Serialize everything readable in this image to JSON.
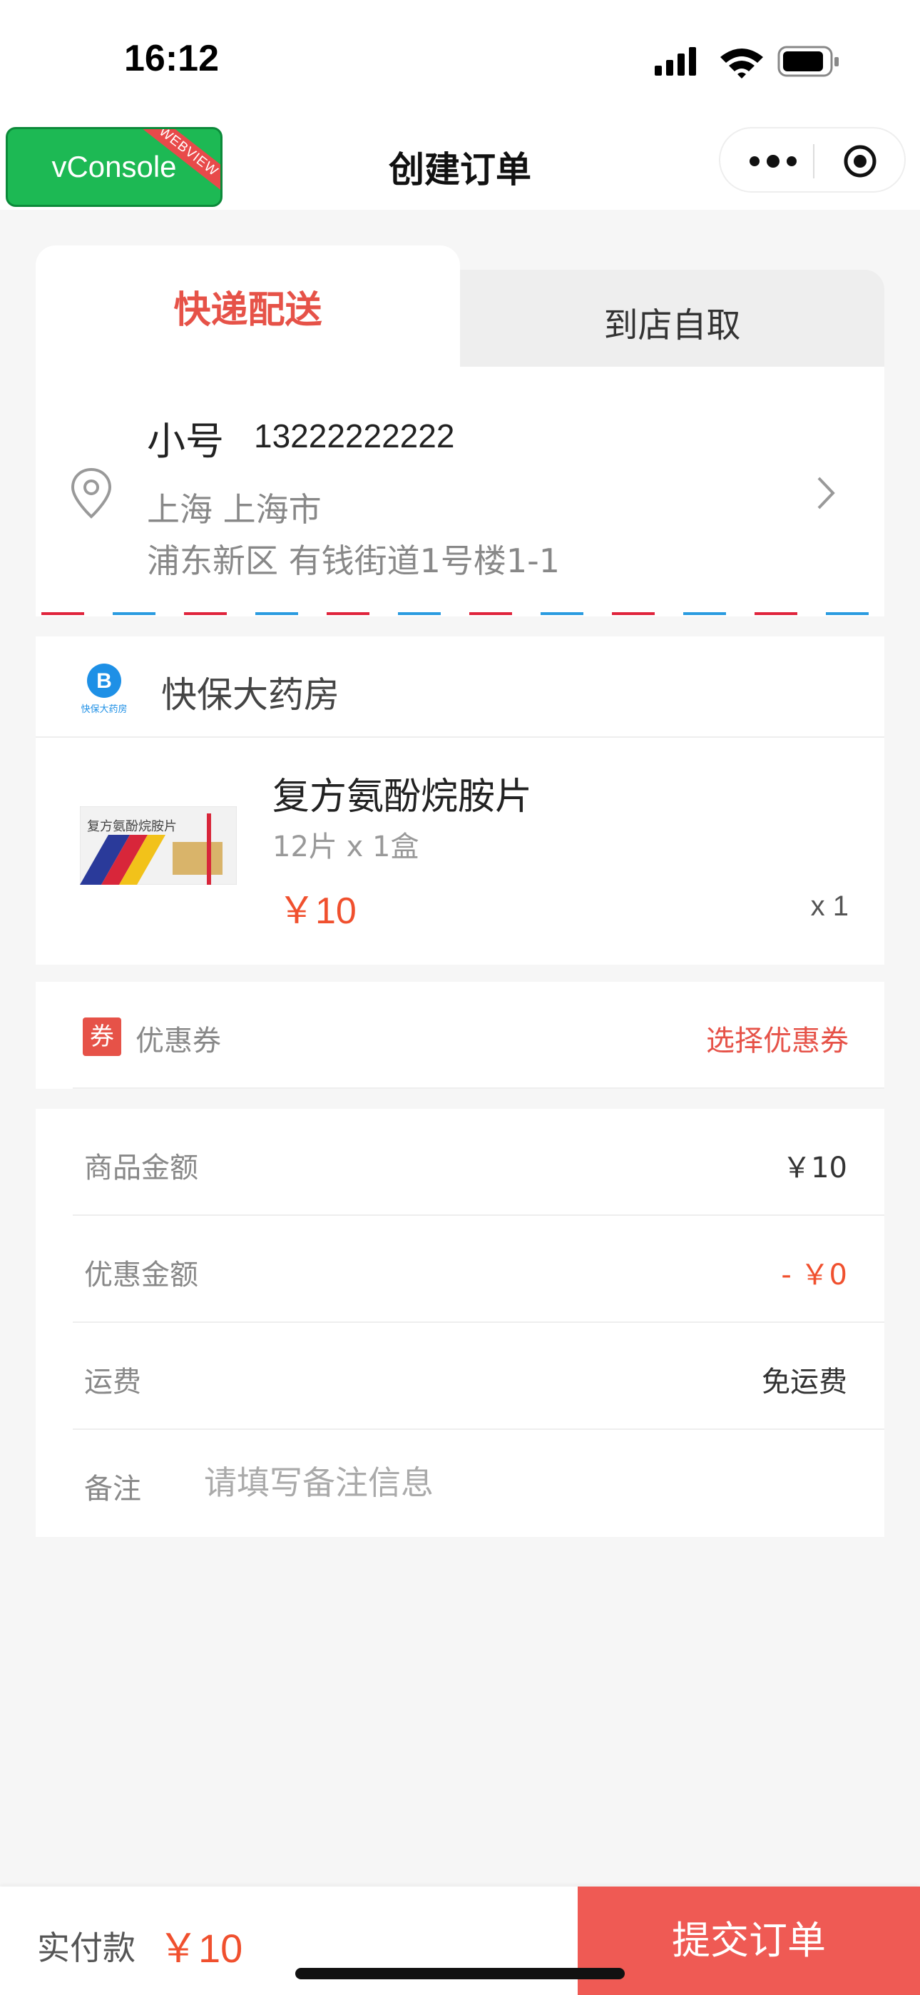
{
  "status_bar": {
    "time": "16:12"
  },
  "nav": {
    "vconsole_label": "vConsole",
    "vconsole_ribbon": "WEBVIEW",
    "title": "创建订单"
  },
  "delivery": {
    "tabs": [
      {
        "label": "快递配送",
        "active": true
      },
      {
        "label": "到店自取",
        "active": false
      }
    ]
  },
  "address": {
    "name": "小号",
    "phone": "13222222222",
    "line1": "上海 上海市",
    "line2": "浦东新区 有钱街道1号楼1-1"
  },
  "shop": {
    "name": "快保大药房",
    "logo_text": "快保大药房"
  },
  "product": {
    "name": "复方氨酚烷胺片",
    "spec": "12片 x 1盒",
    "price": "￥10",
    "qty": "x 1",
    "box_text": "复方氨酚烷胺片"
  },
  "coupon": {
    "tag": "券",
    "label": "优惠券",
    "action": "选择优惠券"
  },
  "summary": {
    "goods_label": "商品金额",
    "goods_value": "￥10",
    "discount_label": "优惠金额",
    "discount_value": "- ￥0",
    "shipping_label": "运费",
    "shipping_value": "免运费",
    "remark_label": "备注",
    "remark_placeholder": "请填写备注信息"
  },
  "footer": {
    "pay_label": "实付款",
    "pay_amount": "￥10",
    "submit_label": "提交订单"
  },
  "colors": {
    "accent": "#e65248",
    "price": "#f0502e",
    "vconsole": "#1db954"
  }
}
